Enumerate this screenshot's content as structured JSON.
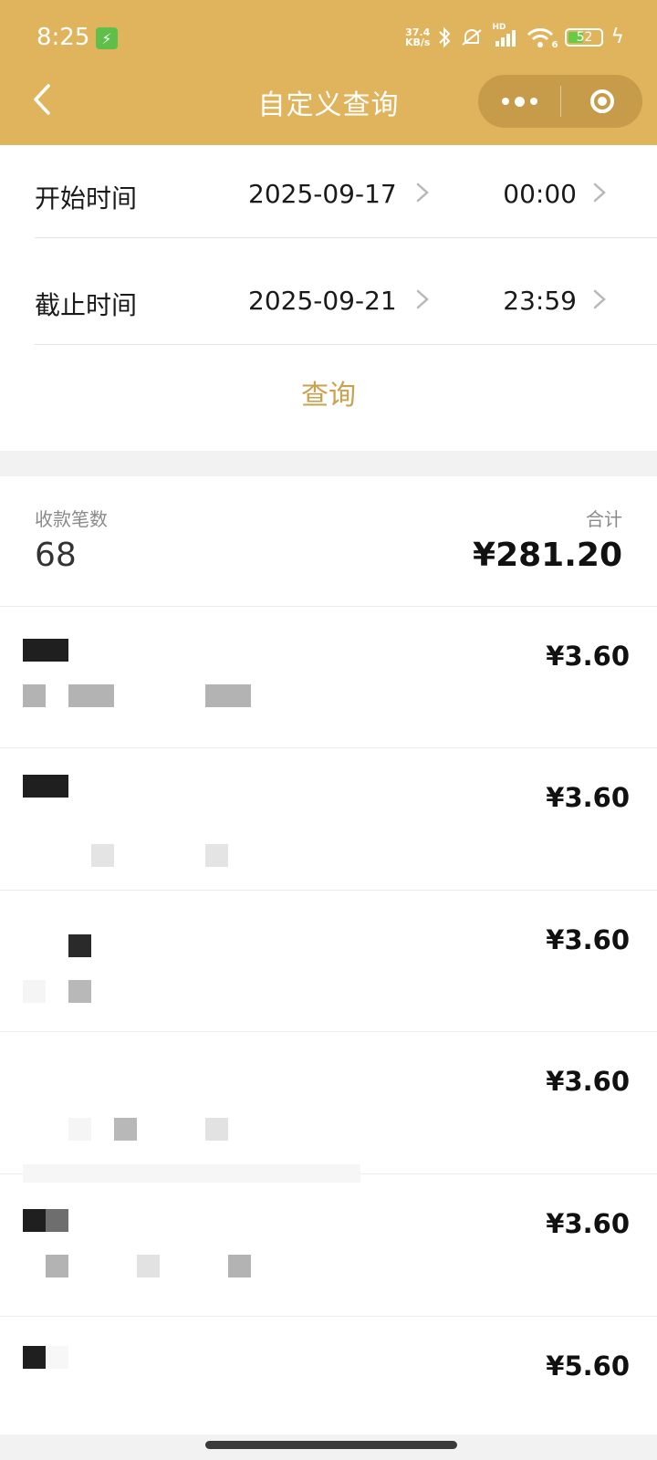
{
  "status_bar": {
    "time": "8:25",
    "net_speed_value": "37.4",
    "net_speed_unit": "KB/s",
    "signal_label": "HD",
    "wifi_label": "6",
    "battery_percent": "52",
    "battery_level": 0.52,
    "icons": [
      "bluetooth-icon",
      "muted-bell-icon",
      "signal-icon",
      "wifi-icon",
      "battery-icon",
      "charging-icon"
    ]
  },
  "nav": {
    "title": "自定义查询"
  },
  "filter": {
    "start": {
      "label": "开始时间",
      "date": "2025-09-17",
      "time": "00:00"
    },
    "end": {
      "label": "截止时间",
      "date": "2025-09-21",
      "time": "23:59"
    },
    "query_label": "查询"
  },
  "summary": {
    "count_label": "收款笔数",
    "count_value": "68",
    "total_label": "合计",
    "total_value": "¥281.20"
  },
  "records": [
    {
      "amount": "¥3.60"
    },
    {
      "amount": "¥3.60"
    },
    {
      "amount": "¥3.60"
    },
    {
      "amount": "¥3.60"
    },
    {
      "amount": "¥3.60"
    },
    {
      "amount": "¥5.60"
    }
  ],
  "colors": {
    "header": "#e0b45c",
    "accent": "#c9a14f"
  }
}
